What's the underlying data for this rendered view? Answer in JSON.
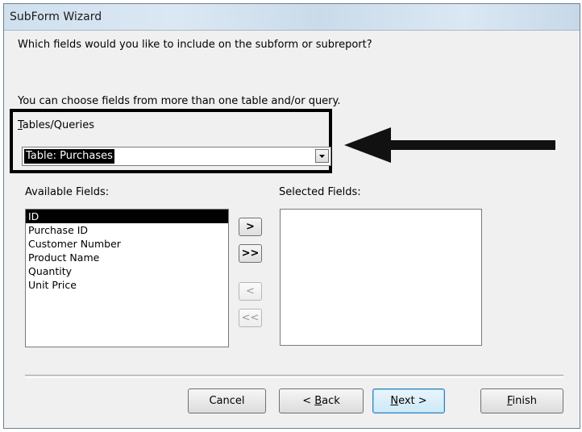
{
  "window": {
    "title": "SubForm Wizard"
  },
  "prompt": "Which fields would you like to include on the subform or subreport?",
  "info": "You can choose fields from more than one table and/or query.",
  "tables_queries": {
    "label": "Tables/Queries",
    "selected": "Table: Purchases"
  },
  "available_fields": {
    "label": "Available Fields:",
    "items": [
      "ID",
      "Purchase ID",
      "Customer Number",
      "Product Name",
      "Quantity",
      "Unit Price"
    ],
    "selected_index": 0
  },
  "selected_fields": {
    "label": "Selected Fields:",
    "items": []
  },
  "move_buttons": {
    "add_one": ">",
    "add_all": ">>",
    "remove_one": "<",
    "remove_all": "<<"
  },
  "footer": {
    "cancel": "Cancel",
    "back": "< Back",
    "next": "Next >",
    "finish": "Finish"
  },
  "colors": {
    "selection": "#000000",
    "annotation": "#000000"
  }
}
